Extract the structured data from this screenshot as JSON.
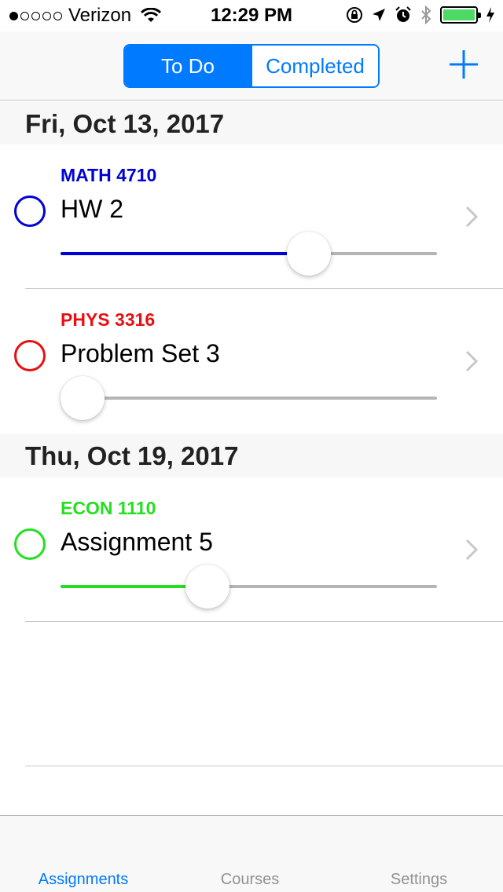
{
  "status_bar": {
    "carrier": "Verizon",
    "signal_bars_filled": 1,
    "signal_bars_total": 5,
    "time": "12:29 PM",
    "battery_level": 1.0
  },
  "nav": {
    "segments": [
      "To Do",
      "Completed"
    ],
    "active_segment": "To Do",
    "accent_color": "#007aff",
    "add_icon": "plus-icon"
  },
  "sections": [
    {
      "date": "Fri, Oct 13, 2017",
      "items": [
        {
          "course": "MATH 4710",
          "title": "HW 2",
          "color": "#0000d8",
          "progress": 0.66
        },
        {
          "course": "PHYS 3316",
          "title": "Problem Set 3",
          "color": "#e81010",
          "progress": 0.0
        }
      ]
    },
    {
      "date": "Thu, Oct 19, 2017",
      "items": [
        {
          "course": "ECON 1110",
          "title": "Assignment 5",
          "color": "#22e01e",
          "progress": 0.39
        }
      ]
    }
  ],
  "tabs": [
    {
      "label": "Assignments",
      "active": true
    },
    {
      "label": "Courses",
      "active": false
    },
    {
      "label": "Settings",
      "active": false
    }
  ]
}
